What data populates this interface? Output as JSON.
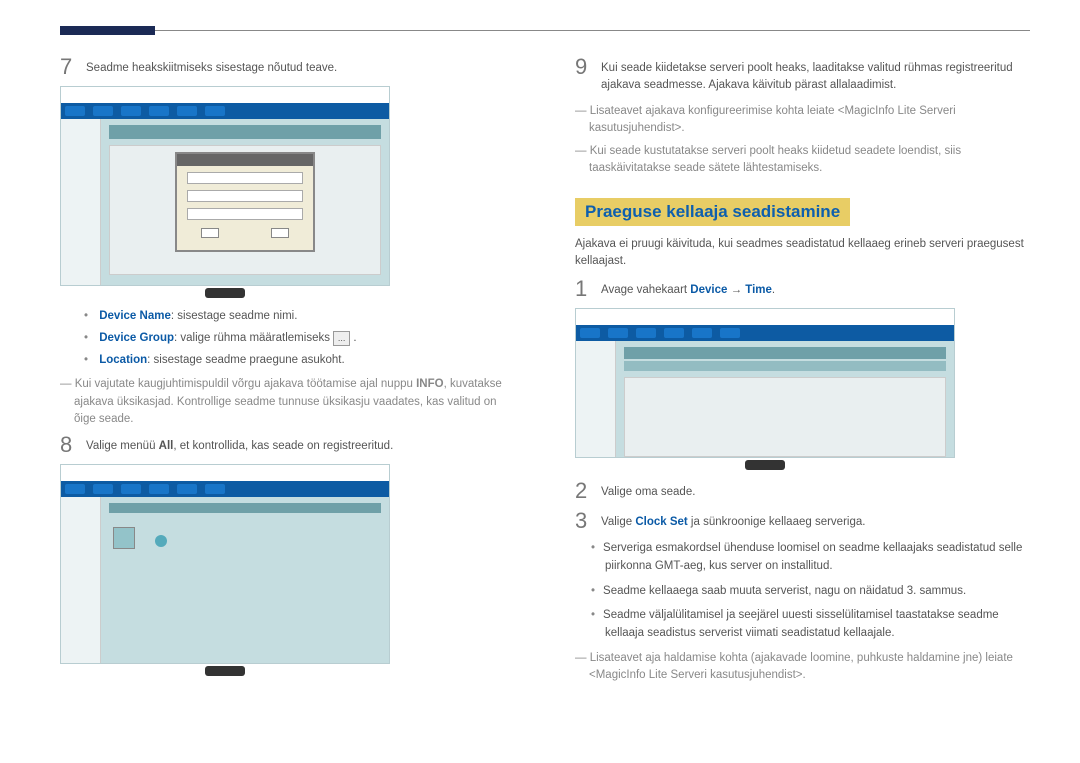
{
  "left": {
    "step7": {
      "num": "7",
      "text": "Seadme heakskiitmiseks sisestage nõutud teave."
    },
    "fields": {
      "deviceName": {
        "label": "Device Name",
        "txt": ": sisestage seadme nimi."
      },
      "deviceGroup": {
        "label": "Device Group",
        "txt": ": valige rühma määratlemiseks "
      },
      "location": {
        "label": "Location",
        "txt": ": sisestage seadme praegune asukoht."
      },
      "btn": "..."
    },
    "note1a": "Kui vajutate kaugjuhtimispuldil võrgu ajakava töötamise ajal nuppu ",
    "note1bold": "INFO",
    "note1b": ", kuvatakse ajakava üksikasjad. Kontrollige seadme tunnuse üksikasju vaadates, kas valitud on õige seade.",
    "step8": {
      "num": "8",
      "textA": "Valige menüü ",
      "bold": "All",
      "textB": ", et kontrollida, kas seade on registreeritud."
    }
  },
  "right": {
    "step9": {
      "num": "9",
      "text": "Kui seade kiidetakse serveri poolt heaks, laaditakse valitud rühmas registreeritud ajakava seadmesse. Ajakava käivitub pärast allalaadimist."
    },
    "note1": "Lisateavet ajakava konfigureerimise kohta leiate <MagicInfo Lite Serveri kasutusjuhendist>.",
    "note2": "Kui seade kustutatakse serveri poolt heaks kiidetud seadete loendist, siis taaskäivitatakse seade sätete lähtestamiseks.",
    "heading": "Praeguse kellaaja seadistamine",
    "intro": "Ajakava ei pruugi käivituda, kui seadmes seadistatud kellaaeg erineb serveri praegusest kellaajast.",
    "step1": {
      "num": "1",
      "textA": "Avage vahekaart ",
      "link1": "Device",
      "arrow": " → ",
      "link2": "Time",
      "dot": "."
    },
    "step2": {
      "num": "2",
      "text": "Valige oma seade."
    },
    "step3": {
      "num": "3",
      "textA": "Valige ",
      "link": "Clock Set",
      "textB": " ja sünkroonige kellaaeg serveriga."
    },
    "bullets": [
      "Serveriga esmakordsel ühenduse loomisel on seadme kellaajaks seadistatud selle piirkonna GMT-aeg, kus server on installitud.",
      "Seadme kellaaega saab muuta serverist, nagu on näidatud 3. sammus.",
      "Seadme väljalülitamisel ja seejärel uuesti sisselülitamisel taastatakse seadme kellaaja seadistus serverist viimati seadistatud kellaajale."
    ],
    "note3": "Lisateavet aja haldamise kohta (ajakavade loomine, puhkuste haldamine jne) leiate <MagicInfo Lite Serveri kasutusjuhendist>."
  }
}
